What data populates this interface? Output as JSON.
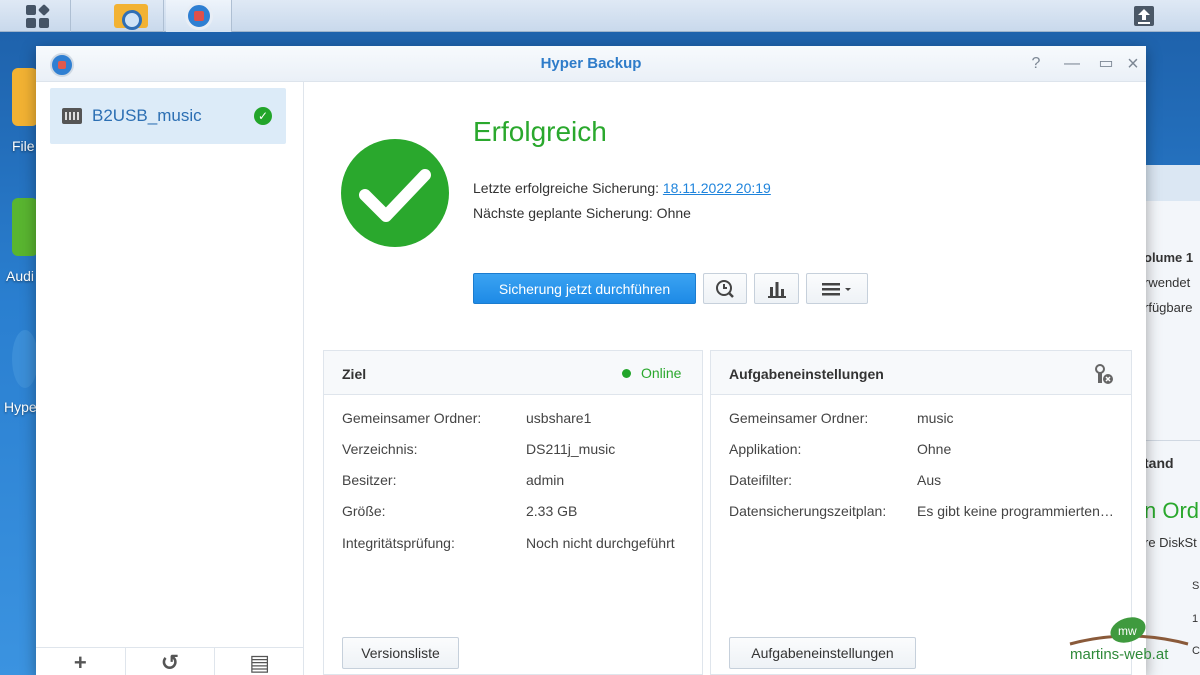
{
  "window": {
    "title": "Hyper Backup"
  },
  "desktop": {
    "labels": [
      "File",
      "Audi",
      "Hype"
    ]
  },
  "background_window": {
    "lines": [
      "olume 1",
      "rwendet",
      "rfügbare",
      "tand",
      "n Ord",
      "re DiskSt",
      "S",
      "1",
      "C"
    ]
  },
  "sidebar": {
    "tasks": [
      {
        "name": "B2USB_music",
        "status": "success"
      }
    ]
  },
  "status": {
    "title": "Erfolgreich",
    "last_backup_label": "Letzte erfolgreiche Sicherung:",
    "last_backup_value": "18.11.2022 20:19",
    "next_backup": "Nächste geplante Sicherung: Ohne",
    "backup_now_label": "Sicherung jetzt durchführen"
  },
  "target_panel": {
    "title": "Ziel",
    "status": "Online",
    "rows": [
      {
        "label": "Gemeinsamer Ordner:",
        "value": "usbshare1"
      },
      {
        "label": "Verzeichnis:",
        "value": "DS211j_music"
      },
      {
        "label": "Besitzer:",
        "value": "admin"
      },
      {
        "label": "Größe:",
        "value": "2.33 GB"
      },
      {
        "label": "Integritätsprüfung:",
        "value": "Noch nicht durchgeführt"
      }
    ],
    "button_label": "Versionsliste"
  },
  "task_panel": {
    "title": "Aufgabeneinstellungen",
    "rows": [
      {
        "label": "Gemeinsamer Ordner:",
        "value": "music"
      },
      {
        "label": "Applikation:",
        "value": "Ohne"
      },
      {
        "label": "Dateifilter:",
        "value": "Aus"
      },
      {
        "label": "Datensicherungszeitplan:",
        "value": "Es gibt keine programmierten Sicherungen"
      }
    ],
    "button_label": "Aufgabeneinstellungen"
  },
  "watermark": {
    "logo_letters": "mw",
    "text": "martins-web.at"
  },
  "colors": {
    "success": "#2aa82d",
    "accent": "#1e8ae6",
    "title": "#2e7cc9"
  }
}
